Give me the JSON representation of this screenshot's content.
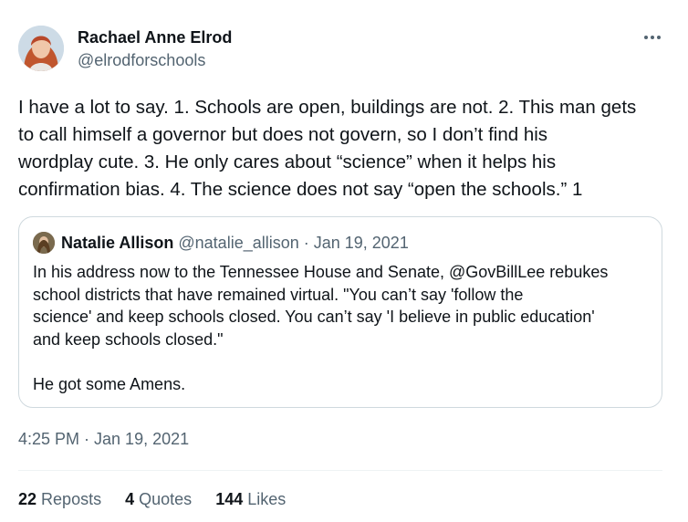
{
  "tweet": {
    "author_name": "Rachael Anne Elrod",
    "author_handle": "@elrodforschools",
    "text_lines": [
      "I have a lot to say. 1. Schools are open, buildings are not. 2. This man gets",
      "to call himself a governor but does not govern, so I don’t find his",
      "wordplay cute. 3. He only cares about “science” when it helps his",
      "confirmation bias. 4. The science does not say “open the schools.” 1"
    ],
    "timestamp": "4:25 PM · Jan 19, 2021"
  },
  "quote": {
    "author_name": "Natalie Allison",
    "meta": "@natalie_allison · Jan 19, 2021",
    "text_lines": [
      "In his address now to the Tennessee House and Senate, @GovBillLee rebukes",
      "school districts that have remained virtual. \"You can’t say 'follow the",
      "science' and keep schools closed. You can’t say 'I believe in public education'",
      "and keep schools closed.\"",
      "",
      "He got some Amens."
    ]
  },
  "stats": [
    {
      "count": "22",
      "label": "Reposts"
    },
    {
      "count": "4",
      "label": "Quotes"
    },
    {
      "count": "144",
      "label": "Likes"
    }
  ],
  "icons": {
    "more": "more-options-icon"
  },
  "colors": {
    "text": "#0f1419",
    "muted": "#536471",
    "border": "#cfd9de"
  }
}
